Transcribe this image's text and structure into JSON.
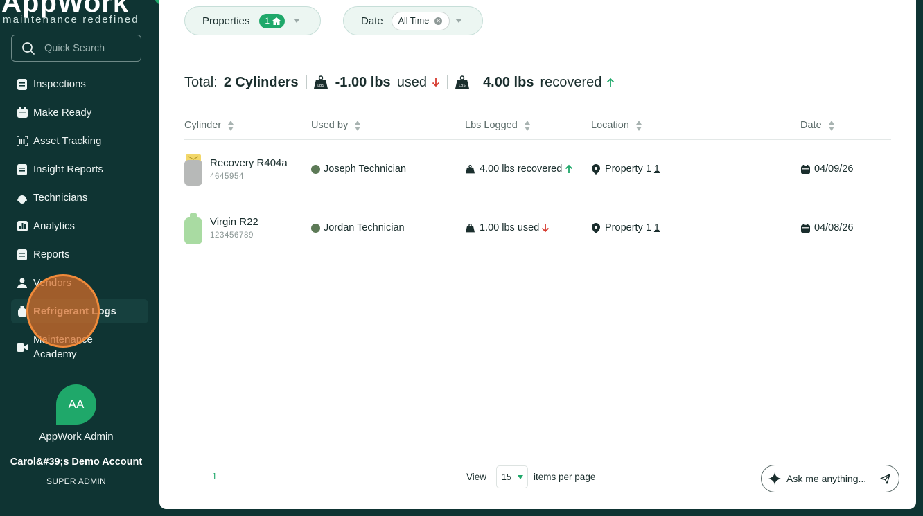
{
  "brand": {
    "name": "AppWork",
    "tagline": "maintenance redefined"
  },
  "search": {
    "placeholder": "Quick Search"
  },
  "sidebar": {
    "items": [
      {
        "label": "Inspections",
        "icon": "clipboard-icon"
      },
      {
        "label": "Make Ready",
        "icon": "calendar-icon"
      },
      {
        "label": "Asset Tracking",
        "icon": "barcode-icon"
      },
      {
        "label": "Insight Reports",
        "icon": "document-icon"
      },
      {
        "label": "Technicians",
        "icon": "hardhat-icon"
      },
      {
        "label": "Analytics",
        "icon": "bar-chart-icon"
      },
      {
        "label": "Reports",
        "icon": "document-icon"
      },
      {
        "label": "Vendors",
        "icon": "person-icon"
      },
      {
        "label": "Refrigerant Logs",
        "icon": "cylinder-icon",
        "active": true
      },
      {
        "label": "Maintenance Academy",
        "icon": "video-icon"
      }
    ]
  },
  "user": {
    "initials": "AA",
    "name": "AppWork Admin",
    "account": "Carol&#39;s Demo Account",
    "role": "SUPER ADMIN"
  },
  "filters": {
    "properties": {
      "label": "Properties",
      "count": "1"
    },
    "date": {
      "label": "Date",
      "value": "All Time"
    }
  },
  "totals": {
    "prefix": "Total:",
    "cylinders": "2 Cylinders",
    "used_value": "-1.00 lbs",
    "used_label": "used",
    "recovered_value": "4.00 lbs",
    "recovered_label": "recovered"
  },
  "table": {
    "headers": [
      "Cylinder",
      "Used by",
      "Lbs Logged",
      "Location",
      "Date"
    ],
    "rows": [
      {
        "name": "Recovery R404a",
        "id": "4645954",
        "user": "Joseph Technician",
        "lbs": "4.00 lbs recovered",
        "direction": "up",
        "location": "Property 1",
        "location_count": "1",
        "date": "04/09/26",
        "cylinder_color": "#b7b9b8",
        "cap_color": "#f2d76a"
      },
      {
        "name": "Virgin R22",
        "id": "123456789",
        "user": "Jordan Technician",
        "lbs": "1.00 lbs used",
        "direction": "down",
        "location": "Property 1",
        "location_count": "1",
        "date": "04/08/26",
        "cylinder_color": "#a9dba2",
        "cap_color": "#a9dba2"
      }
    ]
  },
  "pagination": {
    "page": "1",
    "view_label": "View",
    "per_page": "15",
    "suffix": "items per page"
  },
  "assistant": {
    "placeholder": "Ask me anything..."
  },
  "colors": {
    "accent": "#1fa86a",
    "sidebar": "#0f3433",
    "up": "#1fa86a",
    "down": "#d63b2f"
  }
}
